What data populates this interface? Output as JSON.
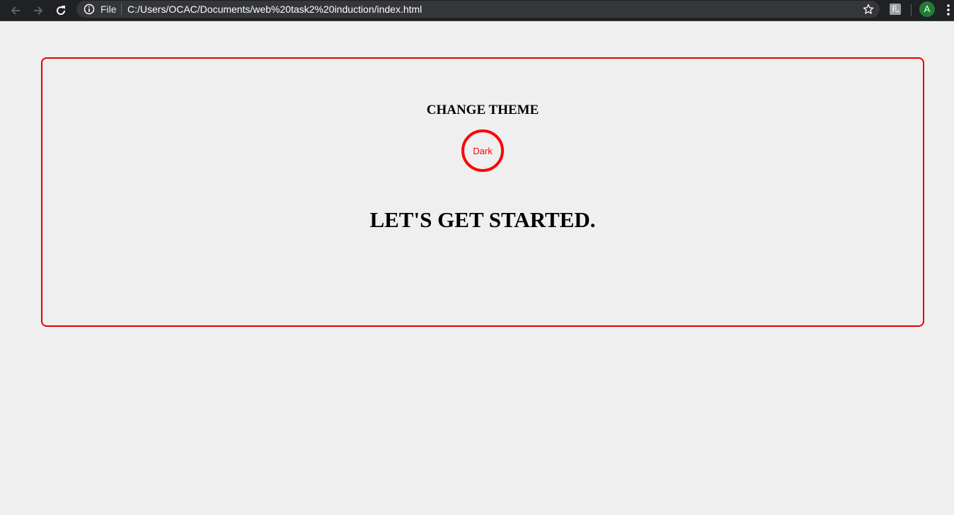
{
  "browser": {
    "back_icon": "arrow-left-icon",
    "forward_icon": "arrow-right-icon",
    "reload_icon": "reload-icon",
    "info_icon": "info-icon",
    "scheme_label": "File",
    "url": "C:/Users/OCAC/Documents/web%20task2%20induction/index.html",
    "star_icon": "star-icon",
    "extension_icon": "extension-icon",
    "extension_glyph": "扎",
    "avatar_letter": "A",
    "menu_icon": "kebab-menu-icon"
  },
  "page": {
    "theme_label": "CHANGE THEME",
    "theme_button_label": "Dark",
    "heading": "LET'S GET STARTED."
  },
  "colors": {
    "border_accent": "#e60000",
    "toggle_accent": "#ff0000",
    "page_background": "#efefef",
    "toolbar_background": "#202124",
    "avatar_background": "#1e7e34"
  }
}
